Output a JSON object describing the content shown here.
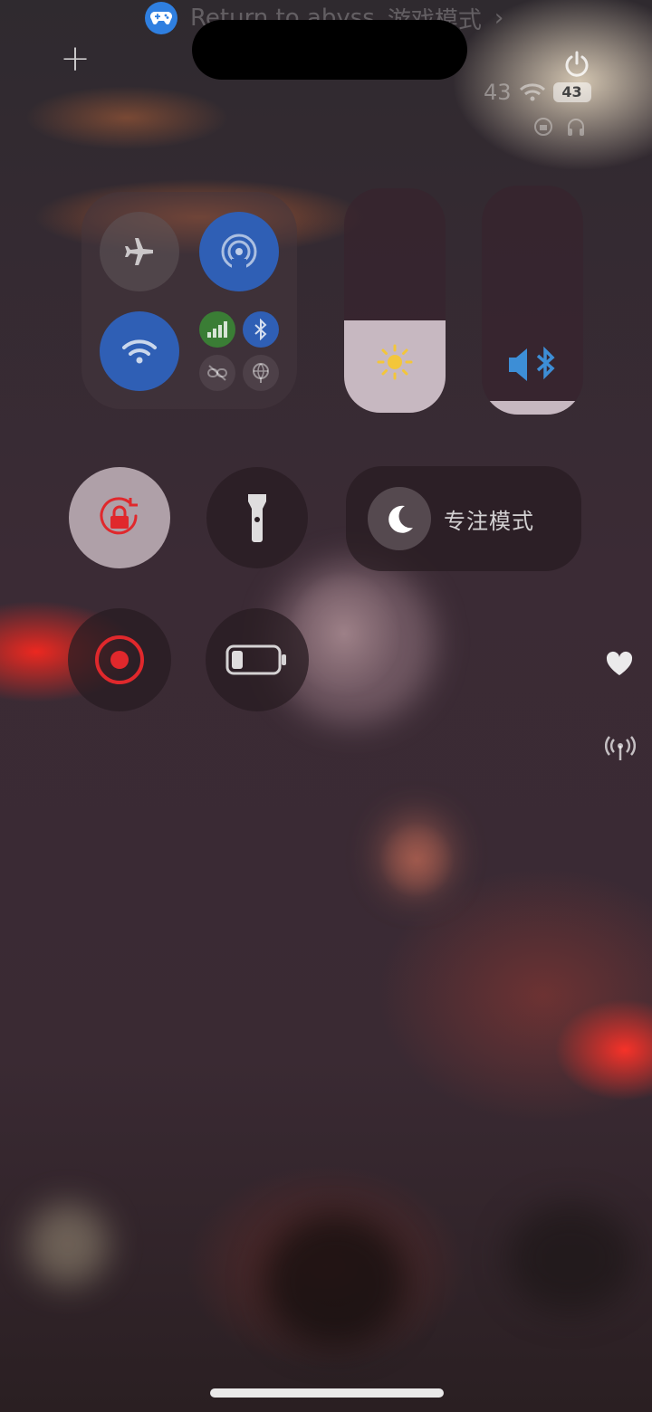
{
  "banner": {
    "app_name": "Return to abyss",
    "mode_text": "游戏模式"
  },
  "status": {
    "signal_text": "43",
    "battery_level": "43"
  },
  "connectivity": {
    "airplane": {
      "active": false
    },
    "airdrop": {
      "active": true
    },
    "wifi": {
      "active": true
    },
    "cellular": {
      "active": true
    },
    "bluetooth": {
      "active": true
    },
    "hotspot": {
      "active": false
    },
    "vpn": {
      "active": false
    }
  },
  "sliders": {
    "brightness": {
      "level": 0.41
    },
    "volume": {
      "level": 0.06
    }
  },
  "focus": {
    "label": "专注模式"
  },
  "colors": {
    "accent_blue": "#2f6fd0",
    "cellular_green": "#3f8f3a",
    "record_red": "#e0282c",
    "sun_yellow": "#f3c63a"
  }
}
